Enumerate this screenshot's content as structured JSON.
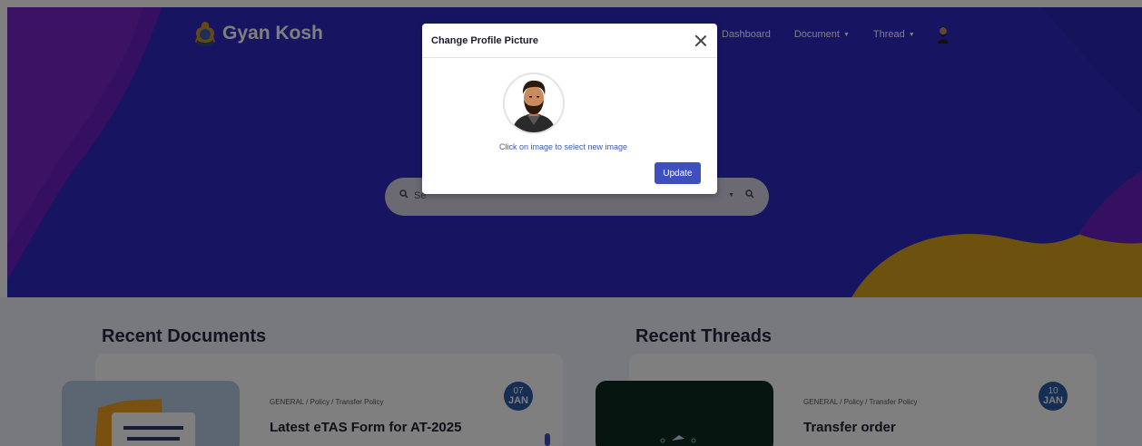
{
  "brand": {
    "name": "Gyan Kosh",
    "logo_icon": "emblem-icon"
  },
  "nav": {
    "items": [
      {
        "label": "Dashboard",
        "caret": false
      },
      {
        "label": "Document",
        "caret": true
      },
      {
        "label": "Thread",
        "caret": true
      }
    ],
    "avatar_icon": "user-avatar-icon"
  },
  "search": {
    "placeholder": "Se",
    "search_icon": "search-icon"
  },
  "sections": {
    "documents": {
      "title": "Recent Documents",
      "item": {
        "breadcrumb": "GENERAL / Policy / Transfer Policy",
        "title": "Latest eTAS Form for AT-2025",
        "date_day": "07",
        "date_month": "JAN"
      }
    },
    "threads": {
      "title": "Recent Threads",
      "item": {
        "breadcrumb": "GENERAL / Policy / Transfer Policy",
        "title": "Transfer order",
        "date_day": "10",
        "date_month": "JAN"
      }
    }
  },
  "modal": {
    "title": "Change Profile Picture",
    "hint": "Click on image to select new image",
    "update_label": "Update"
  },
  "colors": {
    "hero_blue": "#2f2ac2",
    "accent_purple": "#6a1fc2",
    "accent_gold": "#d9a21f",
    "update_button": "#3d50bd",
    "badge_blue": "#2c5aa8"
  }
}
